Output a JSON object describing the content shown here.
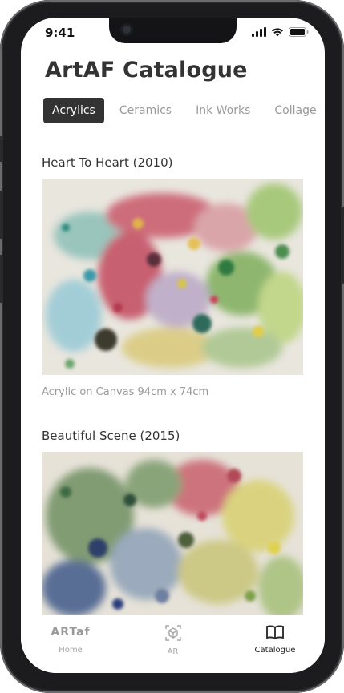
{
  "status": {
    "time": "9:41"
  },
  "app": {
    "title": "ArtAF Catalogue"
  },
  "tabs": [
    {
      "label": "Acrylics",
      "active": true
    },
    {
      "label": "Ceramics",
      "active": false
    },
    {
      "label": "Ink Works",
      "active": false
    },
    {
      "label": "Collage",
      "active": false
    }
  ],
  "artworks": [
    {
      "title": "Heart To Heart (2010)",
      "caption": "Acrylic on Canvas 94cm x 74cm"
    },
    {
      "title": "Beautiful Scene (2015)"
    }
  ],
  "tabbar": {
    "home": {
      "logo": "ARTaf",
      "label": "Home"
    },
    "ar": {
      "label": "AR"
    },
    "catalogue": {
      "label": "Catalogue"
    }
  },
  "icons": {
    "signal": "cellular-signal-icon",
    "wifi": "wifi-icon",
    "battery": "battery-icon",
    "ar": "ar-cube-icon",
    "catalogue": "open-book-icon"
  },
  "colors": {
    "active_tab_bg": "#333333",
    "inactive_text": "#9a9a9a"
  }
}
